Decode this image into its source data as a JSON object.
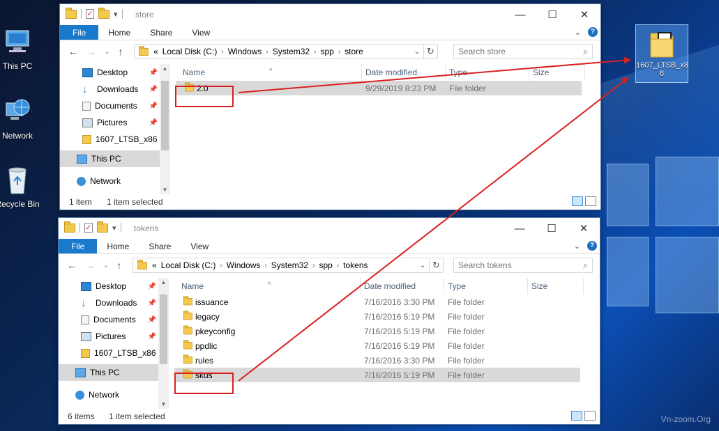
{
  "desktop": {
    "icons": [
      {
        "label": "This PC"
      },
      {
        "label": "Network"
      },
      {
        "label": "Recycle Bin"
      }
    ],
    "selected_icon": {
      "label_line1": "1607_LTSB_x8",
      "label_line2": "6"
    },
    "watermark": "Vn-zoom.Org"
  },
  "windows": [
    {
      "title": "store",
      "ribbon": {
        "file": "File",
        "home": "Home",
        "share": "Share",
        "view": "View"
      },
      "breadcrumb": {
        "overflow": "«",
        "parts": [
          "Local Disk (C:)",
          "Windows",
          "System32",
          "spp",
          "store"
        ]
      },
      "search_placeholder": "Search store",
      "nav": [
        "Desktop",
        "Downloads",
        "Documents",
        "Pictures",
        "1607_LTSB_x86",
        "This PC",
        "Network"
      ],
      "columns": {
        "name": "Name",
        "date": "Date modified",
        "type": "Type",
        "size": "Size"
      },
      "rows": [
        {
          "name": "2.0",
          "date": "9/29/2019 8:23 PM",
          "type": "File folder",
          "selected": true
        }
      ],
      "status": {
        "count": "1 item",
        "selection": "1 item selected"
      }
    },
    {
      "title": "tokens",
      "ribbon": {
        "file": "File",
        "home": "Home",
        "share": "Share",
        "view": "View"
      },
      "breadcrumb": {
        "overflow": "«",
        "parts": [
          "Local Disk (C:)",
          "Windows",
          "System32",
          "spp",
          "tokens"
        ]
      },
      "search_placeholder": "Search tokens",
      "nav": [
        "Desktop",
        "Downloads",
        "Documents",
        "Pictures",
        "1607_LTSB_x86",
        "This PC",
        "Network"
      ],
      "columns": {
        "name": "Name",
        "date": "Date modified",
        "type": "Type",
        "size": "Size"
      },
      "rows": [
        {
          "name": "issuance",
          "date": "7/16/2016 3:30 PM",
          "type": "File folder",
          "selected": false
        },
        {
          "name": "legacy",
          "date": "7/16/2016 5:19 PM",
          "type": "File folder",
          "selected": false
        },
        {
          "name": "pkeyconfig",
          "date": "7/16/2016 5:19 PM",
          "type": "File folder",
          "selected": false
        },
        {
          "name": "ppdlic",
          "date": "7/16/2016 5:19 PM",
          "type": "File folder",
          "selected": false
        },
        {
          "name": "rules",
          "date": "7/16/2016 3:30 PM",
          "type": "File folder",
          "selected": false
        },
        {
          "name": "skus",
          "date": "7/16/2016 5:19 PM",
          "type": "File folder",
          "selected": true
        }
      ],
      "status": {
        "count": "6 items",
        "selection": "1 item selected"
      }
    }
  ],
  "colors": {
    "accent": "#1979ca",
    "annotation": "#d92020",
    "folder": "#f3c94e"
  }
}
